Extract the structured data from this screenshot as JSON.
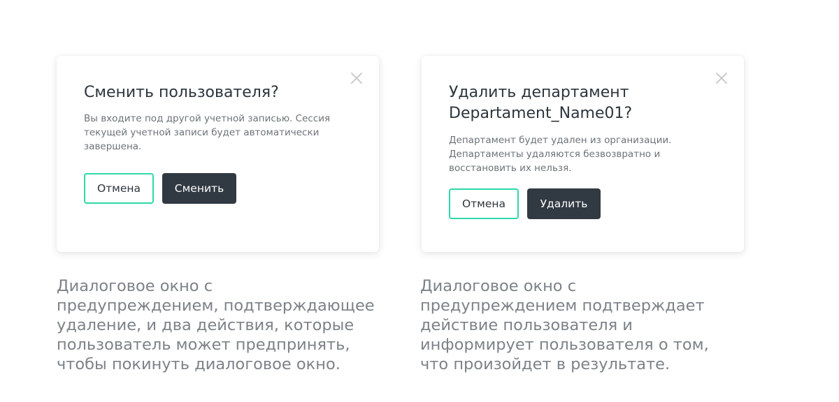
{
  "colors": {
    "accent": "#2ed9a8",
    "primary_button": "#313a43",
    "title_text": "#2d353c",
    "body_text": "#6d7278",
    "caption_text": "#7d8288",
    "close_icon": "#c9ccd0"
  },
  "dialogs": [
    {
      "close_icon": "close-icon",
      "title": "Сменить пользователя?",
      "body": "Вы входите под другой учетной записью. Сессия текущей учетной записи будет автоматически завершена.",
      "cancel_label": "Отмена",
      "confirm_label": "Сменить",
      "caption": "Диалоговое окно с предупреждением, подтверждающее удаление, и два действия, которые пользователь может предпринять, чтобы покинуть диалоговое окно."
    },
    {
      "close_icon": "close-icon",
      "title": "Удалить департамент Departament_Name01?",
      "body": "Департамент будет удален из организации. Департаменты удаляются безвозвратно и восстановить их нельзя.",
      "cancel_label": "Отмена",
      "confirm_label": "Удалить",
      "caption": "Диалоговое окно с предупреждением подтверждает действие пользователя и информирует пользователя о том, что произойдет в результате."
    }
  ]
}
